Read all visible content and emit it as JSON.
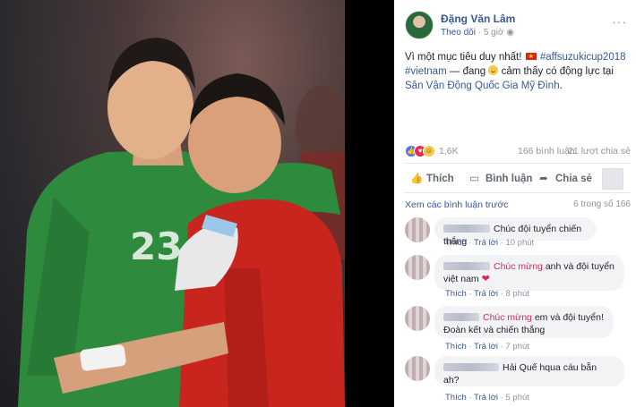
{
  "post": {
    "author": "Đặng Văn Lâm",
    "follow": "Theo dõi",
    "time": "5 giờ",
    "more": "···",
    "caption": {
      "text1": "Vì một mục tiêu duy nhất!",
      "hashtag1": "#affsuzukicup2018",
      "hashtag2": "#vietnam",
      "text2": "— đang",
      "text3": "cảm thấy có động lực tại",
      "place": "Sân Vận Động Quốc Gia Mỹ Đình",
      "end": "."
    }
  },
  "stats": {
    "reactions": "1,6K",
    "comments": "166 bình luận",
    "shares": "21 lượt chia sẻ"
  },
  "actions": {
    "like": "Thích",
    "comment": "Bình luận",
    "share": "Chia sẻ"
  },
  "comments_section": {
    "view_previous": "Xem các bình luận trước",
    "count": "6 trong số 166"
  },
  "comments": [
    {
      "pre": "",
      "highlight": "",
      "text": "Chúc đội tuyển chiến thắng",
      "like": "Thích",
      "reply": "Trả lời",
      "time": "10 phút"
    },
    {
      "pre": "",
      "highlight": "Chúc mừng",
      "text": "anh và đội tuyển",
      "line2": "việt nam",
      "like": "Thích",
      "reply": "Trả lời",
      "time": "8 phút"
    },
    {
      "pre": "",
      "highlight": "Chúc mừng",
      "text": "em và đội tuyển!",
      "line2": "Đoàn kết và chiến thắng",
      "like": "Thích",
      "reply": "Trả lời",
      "time": "7 phút"
    },
    {
      "pre": "",
      "highlight": "",
      "text": "Hải Quế hqua cáu bẵn",
      "line2": "ah?",
      "like": "Thích",
      "reply": "Trả lời",
      "time": "5 phút"
    }
  ],
  "photo": {
    "jersey_number": "23"
  },
  "colors": {
    "link": "#365899",
    "gray_text": "#90949c",
    "highlight": "#e0245e",
    "bubble_bg": "#f2f3f5",
    "goalkeeper_green": "#2e8b3e",
    "vietnam_red": "#c8251f"
  },
  "icons": {
    "like": "thumbs-up-icon",
    "comment": "speech-bubble-icon",
    "share": "share-arrow-icon",
    "more": "more-dots-icon"
  }
}
